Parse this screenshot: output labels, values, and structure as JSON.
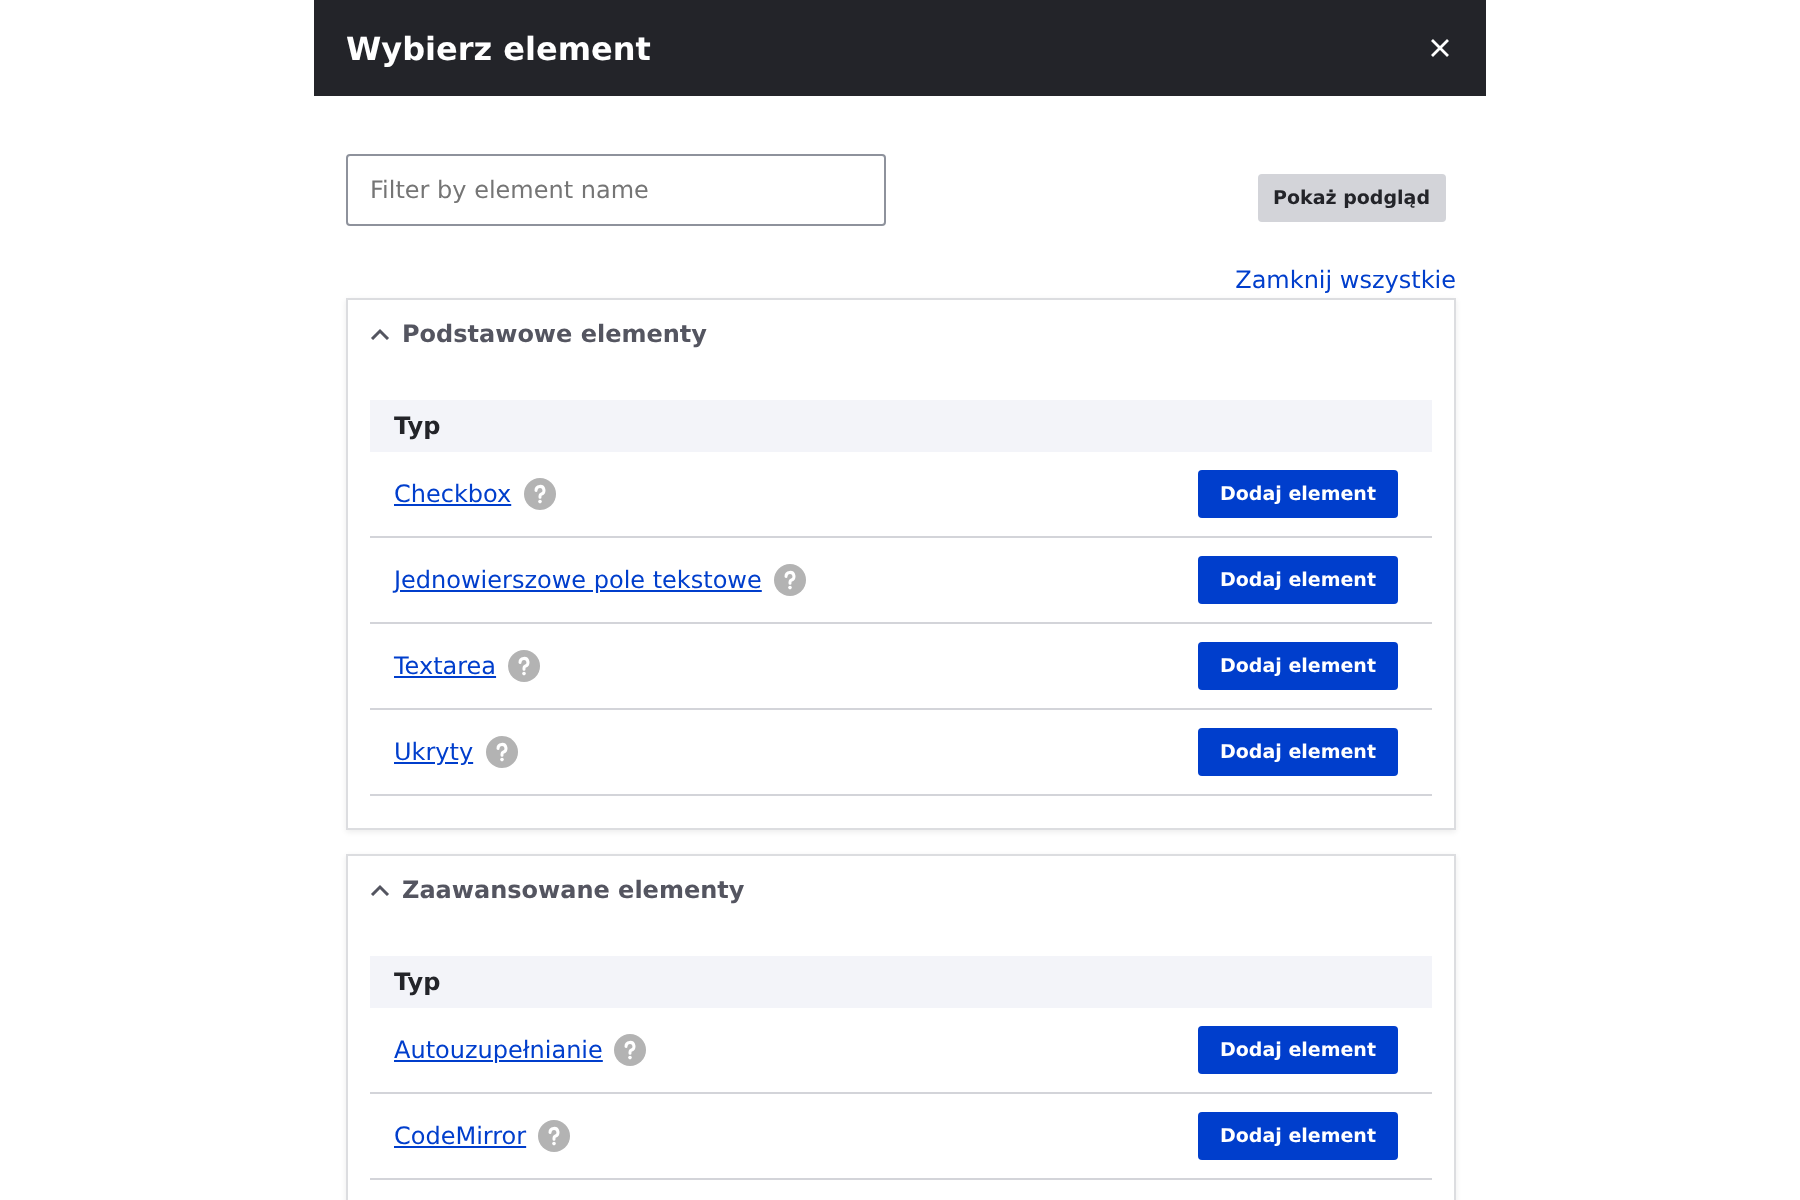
{
  "dialog": {
    "title": "Wybierz element"
  },
  "filter": {
    "placeholder": "Filter by element name"
  },
  "preview_button": "Pokaż podgląd",
  "collapse_all_link": "Zamknij wszystkie",
  "sections": [
    {
      "title": "Podstawowe elementy",
      "expanded": true,
      "column": "Typ",
      "rows": [
        {
          "name": "Checkbox",
          "action": "Dodaj element"
        },
        {
          "name": "Jednowierszowe pole tekstowe",
          "action": "Dodaj element"
        },
        {
          "name": "Textarea",
          "action": "Dodaj element"
        },
        {
          "name": "Ukryty",
          "action": "Dodaj element"
        }
      ]
    },
    {
      "title": "Zaawansowane elementy",
      "expanded": true,
      "column": "Typ",
      "rows": [
        {
          "name": "Autouzupełnianie",
          "action": "Dodaj element"
        },
        {
          "name": "CodeMirror",
          "action": "Dodaj element"
        }
      ]
    }
  ]
}
